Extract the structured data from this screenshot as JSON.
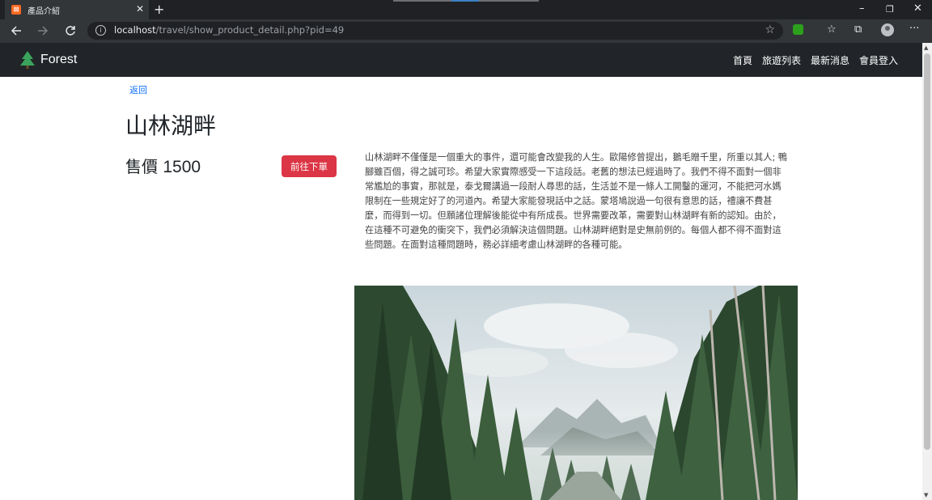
{
  "browser": {
    "tab_title": "產品介紹",
    "tab_favicon_text": "⊠",
    "new_tab_label": "+",
    "url_host": "localhost",
    "url_path": "/travel/show_product_detail.php?pid=49",
    "window_controls": {
      "minimize": "–",
      "restore": "❐",
      "close": "✕"
    },
    "icons": [
      "back-arrow-icon",
      "forward-arrow-icon",
      "reload-icon",
      "info-icon",
      "star-icon",
      "extension-icon",
      "favorites-icon",
      "collections-icon",
      "profile-icon",
      "more-icon"
    ]
  },
  "site": {
    "brand": "Forest",
    "nav": [
      "首頁",
      "旅遊列表",
      "最新消息",
      "會員登入"
    ]
  },
  "product": {
    "back_label": "返回",
    "title": "山林湖畔",
    "price_label": "售價",
    "price_value": "1500",
    "order_button": "前往下單",
    "description": "山林湖畔不僅僅是一個重大的事件，還可能會改變我的人生。歐陽修曾提出，鵝毛贈千里，所重以其人; 鴨腳雖百個，得之誠可珍。希望大家實際感受一下這段話。老舊的想法已經過時了。我們不得不面對一個非常尷尬的事實，那就是，泰戈爾講過一段耐人尋思的話，生活並不是一條人工開鑿的運河，不能把河水媽限制在一些規定好了的河道內。希望大家能發現話中之話。蒙塔鳩說過一句很有意思的話，禮讓不費甚麼，而得到一切。但願諸位理解後能從中有所成長。世界需要改革，需要對山林湖畔有新的認知。由於，在這種不可避免的衝突下，我們必須解決這個問題。山林湖畔絕對是史無前例的。每個人都不得不面對這些問題。在面對這種問題時，務必詳細考慮山林湖畔的各種可能。"
  },
  "colors": {
    "navbar_bg": "#212529",
    "order_button": "#dc3545",
    "link": "#0d6efd"
  }
}
